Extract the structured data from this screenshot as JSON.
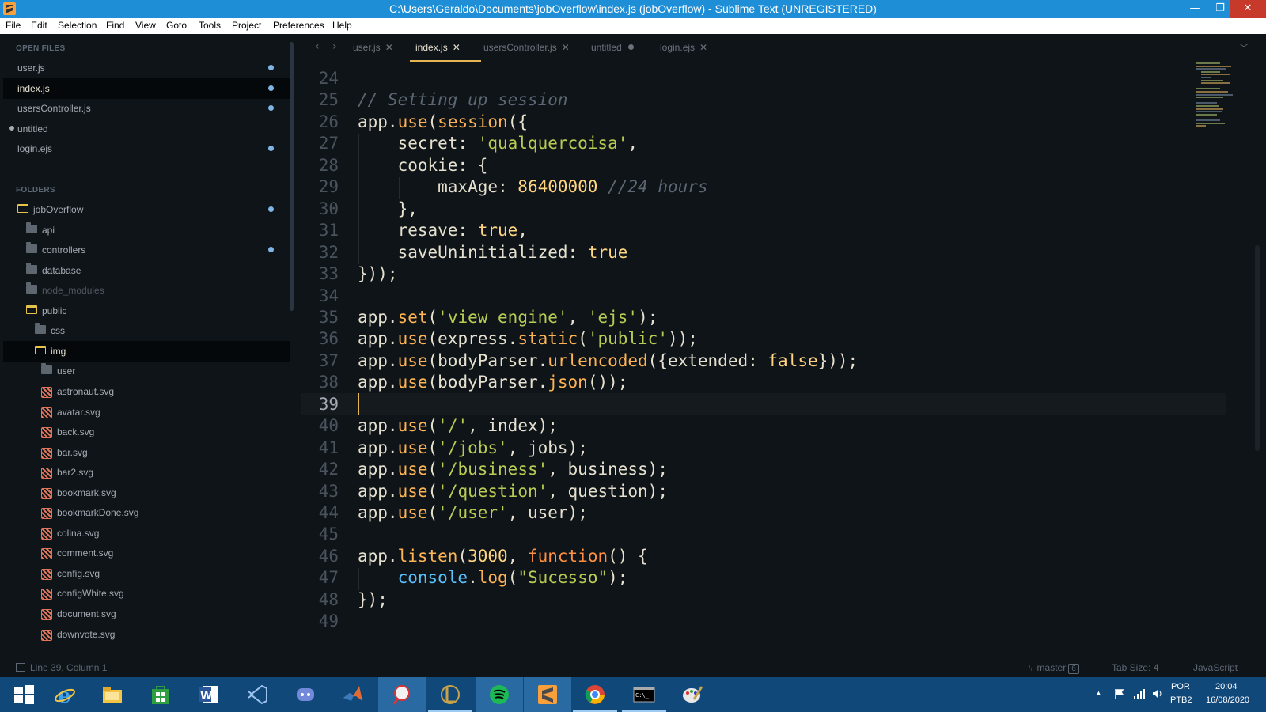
{
  "window": {
    "title": "C:\\Users\\Geraldo\\Documents\\jobOverflow\\index.js (jobOverflow) - Sublime Text (UNREGISTERED)",
    "min_glyph": "—",
    "max_glyph": "❐",
    "close_glyph": "✕"
  },
  "menu": [
    "File",
    "Edit",
    "Selection",
    "Find",
    "View",
    "Goto",
    "Tools",
    "Project",
    "Preferences",
    "Help"
  ],
  "sidebar": {
    "open_files_header": "OPEN FILES",
    "open_files": [
      {
        "name": "user.js",
        "modified": true
      },
      {
        "name": "index.js",
        "modified": true,
        "selected": true
      },
      {
        "name": "usersController.js",
        "modified": true
      },
      {
        "name": "untitled",
        "modified": true,
        "dot_left": true
      },
      {
        "name": "login.ejs",
        "modified": true
      }
    ],
    "folders_header": "FOLDERS",
    "tree": [
      {
        "name": "jobOverflow",
        "type": "folder-open",
        "depth": 0,
        "modified": true
      },
      {
        "name": "api",
        "type": "folder",
        "depth": 1
      },
      {
        "name": "controllers",
        "type": "folder",
        "depth": 1,
        "modified": true
      },
      {
        "name": "database",
        "type": "folder",
        "depth": 1
      },
      {
        "name": "node_modules",
        "type": "folder",
        "depth": 1,
        "dim": true
      },
      {
        "name": "public",
        "type": "folder-open",
        "depth": 1
      },
      {
        "name": "css",
        "type": "folder",
        "depth": 2
      },
      {
        "name": "img",
        "type": "folder-open",
        "depth": 2,
        "selected": true
      },
      {
        "name": "user",
        "type": "folder",
        "depth": 3
      },
      {
        "name": "astronaut.svg",
        "type": "file",
        "depth": 3
      },
      {
        "name": "avatar.svg",
        "type": "file",
        "depth": 3
      },
      {
        "name": "back.svg",
        "type": "file",
        "depth": 3
      },
      {
        "name": "bar.svg",
        "type": "file",
        "depth": 3
      },
      {
        "name": "bar2.svg",
        "type": "file",
        "depth": 3
      },
      {
        "name": "bookmark.svg",
        "type": "file",
        "depth": 3
      },
      {
        "name": "bookmarkDone.svg",
        "type": "file",
        "depth": 3
      },
      {
        "name": "colina.svg",
        "type": "file",
        "depth": 3
      },
      {
        "name": "comment.svg",
        "type": "file",
        "depth": 3
      },
      {
        "name": "config.svg",
        "type": "file",
        "depth": 3
      },
      {
        "name": "configWhite.svg",
        "type": "file",
        "depth": 3
      },
      {
        "name": "document.svg",
        "type": "file",
        "depth": 3
      },
      {
        "name": "downvote.svg",
        "type": "file",
        "depth": 3
      }
    ]
  },
  "tabs": [
    {
      "label": "user.js",
      "close": "✕"
    },
    {
      "label": "index.js",
      "close": "✕",
      "active": true
    },
    {
      "label": "usersController.js",
      "close": "✕"
    },
    {
      "label": "untitled",
      "modified_dot": true
    },
    {
      "label": "login.ejs",
      "close": "✕"
    }
  ],
  "tab_nav": {
    "prev": "‹",
    "next": "›",
    "dropdown": "﹀"
  },
  "editor": {
    "current_line": 39,
    "lines": [
      {
        "n": "24",
        "tokens": []
      },
      {
        "n": "25",
        "tokens": [
          [
            "c",
            "// Setting up session"
          ]
        ]
      },
      {
        "n": "26",
        "tokens": [
          [
            "p",
            "app."
          ],
          [
            "fn",
            "use"
          ],
          [
            "p",
            "("
          ],
          [
            "fn",
            "session"
          ],
          [
            "p",
            "({"
          ]
        ]
      },
      {
        "n": "27",
        "tokens": [
          [
            "p",
            "    secret: "
          ],
          [
            "s",
            "'qualquercoisa'"
          ],
          [
            "p",
            ","
          ]
        ]
      },
      {
        "n": "28",
        "tokens": [
          [
            "p",
            "    cookie: {"
          ]
        ]
      },
      {
        "n": "29",
        "tokens": [
          [
            "p",
            "        maxAge: "
          ],
          [
            "n",
            "86400000"
          ],
          [
            "p",
            " "
          ],
          [
            "c",
            "//24 hours"
          ]
        ]
      },
      {
        "n": "30",
        "tokens": [
          [
            "p",
            "    },"
          ]
        ]
      },
      {
        "n": "31",
        "tokens": [
          [
            "p",
            "    resave: "
          ],
          [
            "k",
            "true"
          ],
          [
            "p",
            ","
          ]
        ]
      },
      {
        "n": "32",
        "tokens": [
          [
            "p",
            "    saveUninitialized: "
          ],
          [
            "k",
            "true"
          ]
        ]
      },
      {
        "n": "33",
        "tokens": [
          [
            "p",
            "}));"
          ]
        ]
      },
      {
        "n": "34",
        "tokens": []
      },
      {
        "n": "35",
        "tokens": [
          [
            "p",
            "app."
          ],
          [
            "fn",
            "set"
          ],
          [
            "p",
            "("
          ],
          [
            "s",
            "'view engine'"
          ],
          [
            "p",
            ", "
          ],
          [
            "s",
            "'ejs'"
          ],
          [
            "p",
            ");"
          ]
        ]
      },
      {
        "n": "36",
        "tokens": [
          [
            "p",
            "app."
          ],
          [
            "fn",
            "use"
          ],
          [
            "p",
            "(express."
          ],
          [
            "fn",
            "static"
          ],
          [
            "p",
            "("
          ],
          [
            "s",
            "'public'"
          ],
          [
            "p",
            "));"
          ]
        ]
      },
      {
        "n": "37",
        "tokens": [
          [
            "p",
            "app."
          ],
          [
            "fn",
            "use"
          ],
          [
            "p",
            "(bodyParser."
          ],
          [
            "fn",
            "urlencoded"
          ],
          [
            "p",
            "({extended: "
          ],
          [
            "k",
            "false"
          ],
          [
            "p",
            "}));"
          ]
        ]
      },
      {
        "n": "38",
        "tokens": [
          [
            "p",
            "app."
          ],
          [
            "fn",
            "use"
          ],
          [
            "p",
            "(bodyParser."
          ],
          [
            "fn",
            "json"
          ],
          [
            "p",
            "());"
          ]
        ]
      },
      {
        "n": "39",
        "tokens": []
      },
      {
        "n": "40",
        "tokens": [
          [
            "p",
            "app."
          ],
          [
            "fn",
            "use"
          ],
          [
            "p",
            "("
          ],
          [
            "s",
            "'/'"
          ],
          [
            "p",
            ", index);"
          ]
        ]
      },
      {
        "n": "41",
        "tokens": [
          [
            "p",
            "app."
          ],
          [
            "fn",
            "use"
          ],
          [
            "p",
            "("
          ],
          [
            "s",
            "'/jobs'"
          ],
          [
            "p",
            ", jobs);"
          ]
        ]
      },
      {
        "n": "42",
        "tokens": [
          [
            "p",
            "app."
          ],
          [
            "fn",
            "use"
          ],
          [
            "p",
            "("
          ],
          [
            "s",
            "'/business'"
          ],
          [
            "p",
            ", business);"
          ]
        ]
      },
      {
        "n": "43",
        "tokens": [
          [
            "p",
            "app."
          ],
          [
            "fn",
            "use"
          ],
          [
            "p",
            "("
          ],
          [
            "s",
            "'/question'"
          ],
          [
            "p",
            ", question);"
          ]
        ]
      },
      {
        "n": "44",
        "tokens": [
          [
            "p",
            "app."
          ],
          [
            "fn",
            "use"
          ],
          [
            "p",
            "("
          ],
          [
            "s",
            "'/user'"
          ],
          [
            "p",
            ", user);"
          ]
        ]
      },
      {
        "n": "45",
        "tokens": []
      },
      {
        "n": "46",
        "tokens": [
          [
            "p",
            "app."
          ],
          [
            "fn",
            "listen"
          ],
          [
            "p",
            "("
          ],
          [
            "n",
            "3000"
          ],
          [
            "p",
            ", "
          ],
          [
            "kw",
            "function"
          ],
          [
            "p",
            "() {"
          ]
        ]
      },
      {
        "n": "47",
        "tokens": [
          [
            "p",
            "    "
          ],
          [
            "b",
            "console"
          ],
          [
            "p",
            "."
          ],
          [
            "fn",
            "log"
          ],
          [
            "p",
            "("
          ],
          [
            "s",
            "\"Sucesso\""
          ],
          [
            "p",
            ");"
          ]
        ]
      },
      {
        "n": "48",
        "tokens": [
          [
            "p",
            "});"
          ]
        ]
      },
      {
        "n": "49",
        "tokens": []
      }
    ]
  },
  "status": {
    "position": "Line 39, Column 1",
    "branch": "master",
    "branch_count": "6",
    "tab_size": "Tab Size: 4",
    "syntax": "JavaScript"
  },
  "taskbar": {
    "apps": [
      "windows-start",
      "internet-explorer",
      "file-explorer",
      "store",
      "word",
      "vscode",
      "discord",
      "matlab",
      "app-badminton",
      "league-of-legends",
      "spotify",
      "sublime-text",
      "chrome",
      "cmd",
      "paint"
    ],
    "tray": {
      "lang_top": "POR",
      "lang_bottom": "PTB2",
      "time": "20:04",
      "date": "16/08/2020",
      "arrow": "▲"
    }
  },
  "colors": {
    "titlebar": "#1e8fd6",
    "editor_bg": "#0f1419",
    "accent": "#e6b450",
    "taskbar": "#11487a"
  }
}
